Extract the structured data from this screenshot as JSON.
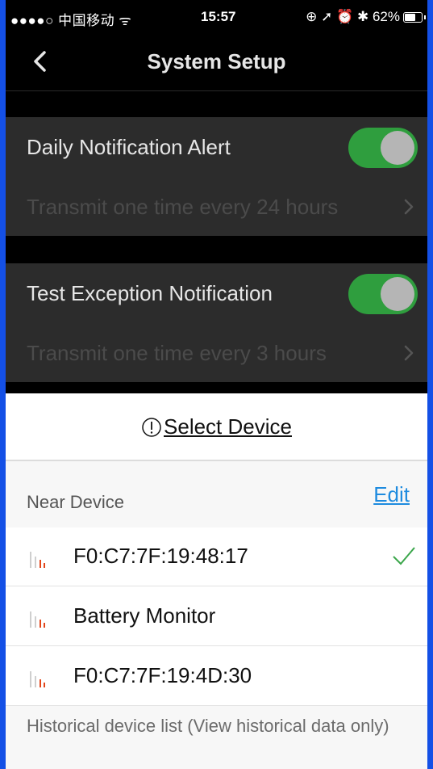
{
  "status_bar": {
    "carrier": "●●●●○ 中国移动 ᯤ",
    "time": "15:57",
    "right_icons": "⊕ ➚ ⏰ ✱ 62%",
    "battery_percent": 62
  },
  "nav": {
    "title": "System Setup",
    "back_icon": "chevron-left-icon"
  },
  "settings": [
    {
      "label": "Daily Notification Alert",
      "enabled": true,
      "subtitle": "Transmit one time every 24 hours"
    },
    {
      "label": "Test Exception Notification",
      "enabled": true,
      "subtitle": "Transmit one time every 3 hours"
    }
  ],
  "sheet": {
    "title": "Select Device",
    "section_label": "Near Device",
    "edit_label": "Edit",
    "devices": [
      {
        "name": "F0:C7:7F:19:48:17",
        "selected": true
      },
      {
        "name": "Battery Monitor",
        "selected": false
      },
      {
        "name": "F0:C7:7F:19:4D:30",
        "selected": false
      }
    ],
    "history_label": "Historical device list (View historical data only)"
  },
  "colors": {
    "toggle_on": "#2f9e3e",
    "link": "#1e8bdf",
    "check": "#3aa64a",
    "signal_accent": "#e2451a",
    "frame_bg": "#1450e6"
  }
}
